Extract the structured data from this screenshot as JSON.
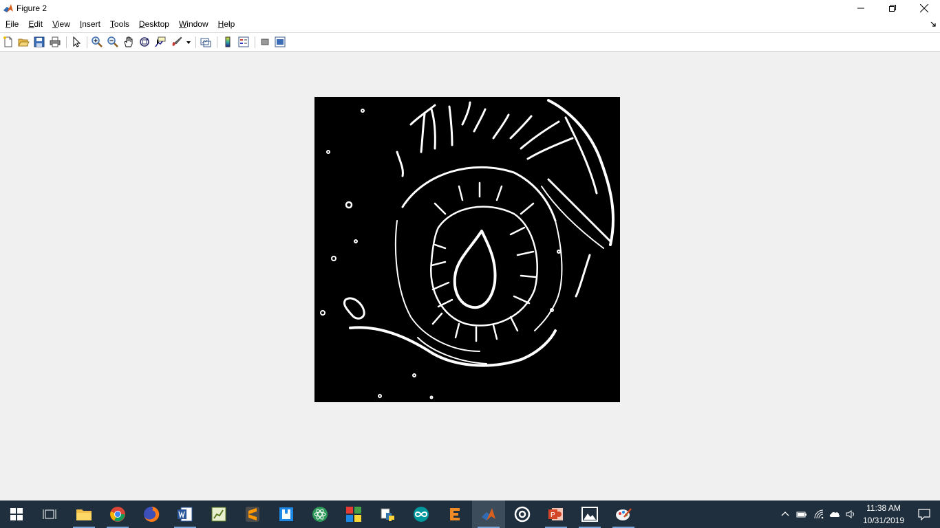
{
  "window": {
    "title": "Figure 2",
    "controls": [
      "minimize",
      "restore",
      "close"
    ]
  },
  "menu": {
    "items": [
      {
        "label": "File",
        "accel": "F"
      },
      {
        "label": "Edit",
        "accel": "E"
      },
      {
        "label": "View",
        "accel": "V"
      },
      {
        "label": "Insert",
        "accel": "I"
      },
      {
        "label": "Tools",
        "accel": "T"
      },
      {
        "label": "Desktop",
        "accel": "D"
      },
      {
        "label": "Window",
        "accel": "W"
      },
      {
        "label": "Help",
        "accel": "H"
      }
    ]
  },
  "toolbar": {
    "buttons": [
      "new-figure-icon",
      "open-file-icon",
      "save-figure-icon",
      "print-figure-icon",
      "edit-plot-icon",
      "zoom-in-icon",
      "zoom-out-icon",
      "pan-icon",
      "rotate-3d-icon",
      "data-cursor-icon",
      "brush-icon",
      "link-plot-icon",
      "insert-colorbar-icon",
      "insert-legend-icon",
      "hide-plot-tools-icon",
      "show-plot-tools-icon"
    ]
  },
  "figure": {
    "content": "binary edge-detected image of an eye (white edges on black background)",
    "colors": {
      "background": "#000000",
      "foreground": "#ffffff"
    }
  },
  "taskbar": {
    "apps": [
      "start-icon",
      "task-view-icon",
      "file-explorer-icon",
      "chrome-icon",
      "firefox-icon",
      "word-icon",
      "spreadsheet-icon",
      "sublime-text-icon",
      "notepad-icon",
      "atom-icon",
      "office-app-icon",
      "python-icon",
      "arduino-icon",
      "eclipse-icon",
      "matlab-icon",
      "obs-icon",
      "powerpoint-icon",
      "photos-icon",
      "paint-icon"
    ],
    "active_app": "matlab-icon",
    "clock": {
      "time": "11:38 AM",
      "date": "10/31/2019"
    }
  }
}
